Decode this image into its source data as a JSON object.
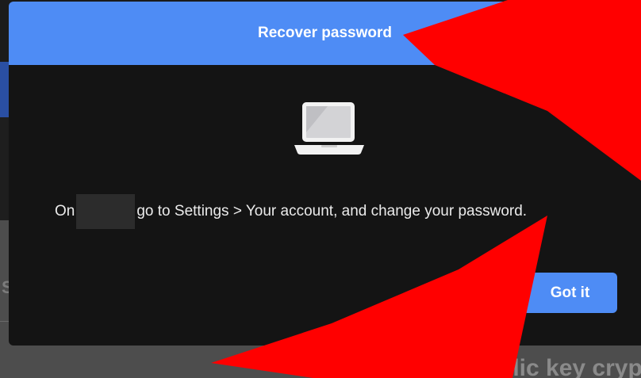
{
  "background": {
    "left_letter": "S",
    "bottom_text": "blic key cryp"
  },
  "modal": {
    "title": "Recover password",
    "message_prefix": "On",
    "message_suffix": "go to Settings > Your account, and change your password.",
    "button_label": "Got it",
    "icon": "laptop-icon"
  },
  "colors": {
    "accent": "#4e8cf5",
    "modal_bg": "#141414",
    "annotation": "#ff0000"
  }
}
